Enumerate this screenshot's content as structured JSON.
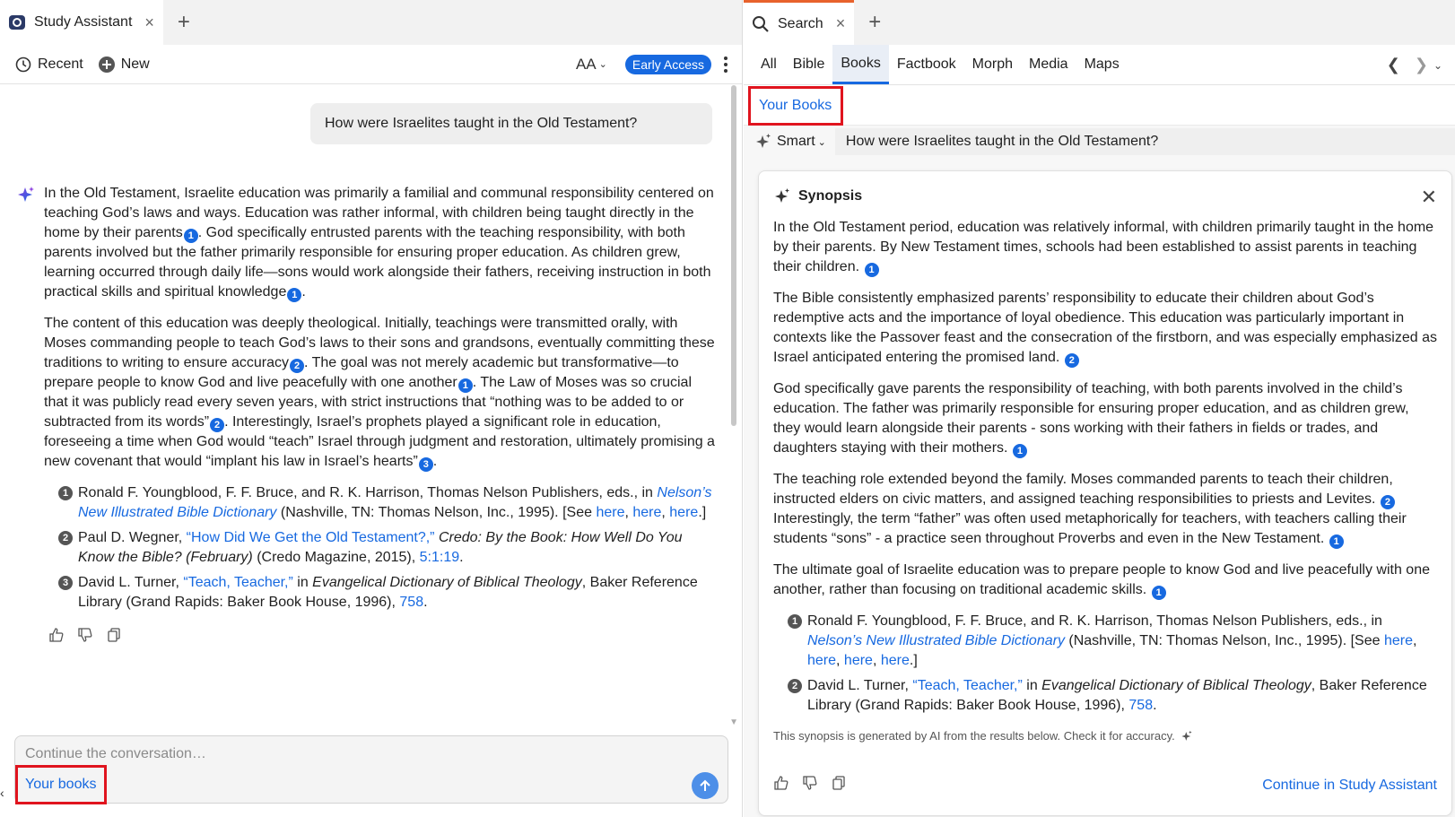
{
  "left": {
    "tab": {
      "title": "Study Assistant",
      "close": "×",
      "add": "+"
    },
    "toolbar": {
      "recent": "Recent",
      "new": "New",
      "font_size": "AA",
      "early_access": "Early Access"
    },
    "question": "How were Israelites taught in the Old Testament?",
    "answer": {
      "p1": {
        "a": "In the Old Testament, Israelite education was primarily a familial and communal responsibility centered on teaching God’s laws and ways. Education was rather informal, with children being taught directly in the home by their parents",
        "c1": "1",
        "b": ". God specifically entrusted parents with the teaching responsibility, with both parents involved but the father primarily responsible for ensuring proper education. As children grew, learning occurred through daily life—sons would work alongside their fathers, receiving instruction in both practical skills and spiritual knowledge",
        "c2": "1",
        "end": "."
      },
      "p2": {
        "a": "The content of this education was deeply theological. Initially, teachings were transmitted orally, with Moses commanding people to teach God’s laws to their sons and grandsons, eventually committing these traditions to writing to ensure accuracy",
        "c1": "2",
        "b": ". The goal was not merely academic but transformative—to prepare people to know God and live peacefully with one another",
        "c2": "1",
        "c": ". The Law of Moses was so crucial that it was publicly read every seven years, with strict instructions that “nothing was to be added to or subtracted from its words”",
        "c3": "2",
        "d": ". Interestingly, Israel’s prophets played a significant role in education, foreseeing a time when God would “teach” Israel through judgment and restoration, ultimately promising a new covenant that would “implant his law in Israel’s hearts”",
        "c4": "3",
        "end": "."
      },
      "refs": [
        {
          "num": "1",
          "pre": "Ronald F. Youngblood, F. F. Bruce, and R. K. Harrison, Thomas Nelson Publishers, eds., in ",
          "title": "Nelson’s New Illustrated Bible Dictionary",
          "post": " (Nashville, TN: Thomas Nelson, Inc., 1995). [See ",
          "link1": "here",
          "sep1": ", ",
          "link2": "here",
          "sep2": ", ",
          "link3": "here",
          "close": ".]"
        },
        {
          "num": "2",
          "pre": "Paul D. Wegner, ",
          "title": "“How Did We Get the Old Testament?,”",
          "mid": " Credo: By the Book: How Well Do You Know the Bible? (February)",
          "post": " (Credo Magazine, 2015), ",
          "link": "5:1:19",
          "close": "."
        },
        {
          "num": "3",
          "pre": "David L. Turner, ",
          "title": "“Teach, Teacher,”",
          "mid1": " in ",
          "book": "Evangelical Dictionary of Biblical Theology",
          "post": ", Baker Reference Library (Grand Rapids: Baker Book House, 1996), ",
          "link": "758",
          "close": "."
        }
      ]
    },
    "input": {
      "placeholder": "Continue the conversation…",
      "chip": "Your books"
    }
  },
  "right": {
    "tab": {
      "title": "Search",
      "close": "×",
      "add": "+"
    },
    "search_tabs": [
      "All",
      "Bible",
      "Books",
      "Factbook",
      "Morph",
      "Media",
      "Maps"
    ],
    "active_tab": "Books",
    "your_books": "Your Books",
    "smart": "Smart",
    "query": "How were Israelites taught in the Old Testament?",
    "synopsis": {
      "title": "Synopsis",
      "p1": "In the Old Testament period, education was relatively informal, with children primarily taught in the home by their parents. By New Testament times, schools had been established to assist parents in teaching their children.",
      "p1c": "1",
      "p2": "The Bible consistently emphasized parents’ responsibility to educate their children about God’s redemptive acts and the importance of loyal obedience. This education was particularly important in contexts like the Passover feast and the consecration of the firstborn, and was especially emphasized as Israel anticipated entering the promised land.",
      "p2c": "2",
      "p3": "God specifically gave parents the responsibility of teaching, with both parents involved in the child’s education. The father was primarily responsible for ensuring proper education, and as children grew, they would learn alongside their parents - sons working with their fathers in fields or trades, and daughters staying with their mothers.",
      "p3c": "1",
      "p4a": "The teaching role extended beyond the family. Moses commanded parents to teach their children, instructed elders on civic matters, and assigned teaching responsibilities to priests and Levites.",
      "p4c1": "2",
      "p4b": " Interestingly, the term “father” was often used metaphorically for teachers, with teachers calling their students “sons” - a practice seen throughout Proverbs and even in the New Testament.",
      "p4c2": "1",
      "p5": "The ultimate goal of Israelite education was to prepare people to know God and live peacefully with one another, rather than focusing on traditional academic skills.",
      "p5c": "1",
      "refs": [
        {
          "num": "1",
          "pre": "Ronald F. Youngblood, F. F. Bruce, and R. K. Harrison, Thomas Nelson Publishers, eds., in ",
          "title": "Nelson’s New Illustrated Bible Dictionary",
          "post": " (Nashville, TN: Thomas Nelson, Inc., 1995). [See ",
          "link1": "here",
          "sep": ", ",
          "link2": "here",
          "link3": "here",
          "link4": "here",
          "close": ".]"
        },
        {
          "num": "2",
          "pre": "David L. Turner, ",
          "title": "“Teach, Teacher,”",
          "mid1": " in ",
          "book": "Evangelical Dictionary of Biblical Theology",
          "post": ", Baker Reference Library (Grand Rapids: Baker Book House, 1996), ",
          "link": "758",
          "close": "."
        }
      ],
      "disclaimer": "This synopsis is generated by AI from the results below. Check it for accuracy.",
      "continue": "Continue in Study Assistant"
    }
  },
  "colors": {
    "accent": "#1769e0",
    "highlight": "#e0141e",
    "tab_active": "#e8622c"
  }
}
